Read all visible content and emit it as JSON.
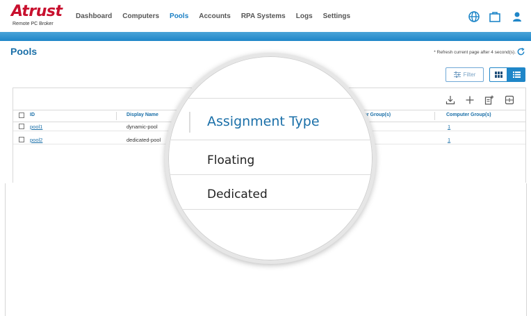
{
  "brand": {
    "name": "Atrust",
    "subtitle": "Remote PC Broker"
  },
  "nav": {
    "items": [
      {
        "label": "Dashboard"
      },
      {
        "label": "Computers"
      },
      {
        "label": "Pools",
        "active": true
      },
      {
        "label": "Accounts"
      },
      {
        "label": "RPA Systems"
      },
      {
        "label": "Logs"
      },
      {
        "label": "Settings"
      }
    ]
  },
  "header_icons": [
    "globe-icon",
    "briefcase-icon",
    "user-icon"
  ],
  "page": {
    "title": "Pools",
    "refresh_note": "* Refresh current page after 4 second(s)."
  },
  "toolbar": {
    "filter_label": "Filter",
    "icons": [
      "download-icon",
      "plus-icon",
      "add-document-icon",
      "column-settings-icon"
    ]
  },
  "table": {
    "columns": [
      "ID",
      "Display Name",
      "er Group(s)",
      "Computer Group(s)"
    ],
    "rows": [
      {
        "id": "pool1",
        "display_name": "dynamic-pool",
        "computer_groups": "1"
      },
      {
        "id": "pool2",
        "display_name": "dedicated-pool",
        "computer_groups": "1"
      }
    ]
  },
  "magnifier": {
    "header": "Assignment Type",
    "values": [
      "Floating",
      "Dedicated"
    ]
  },
  "colors": {
    "brand_red": "#c8102e",
    "accent_blue": "#1f86c8",
    "header_text": "#1a6fa8"
  }
}
